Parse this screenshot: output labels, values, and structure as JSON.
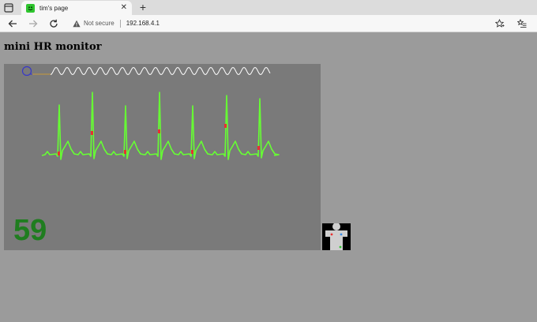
{
  "browser": {
    "tab_title": "tim's page",
    "tab_close_glyph": "✕",
    "new_tab_glyph": "+",
    "security_label": "Not secure",
    "url": "192.168.4.1"
  },
  "page": {
    "title": "mini HR monitor",
    "heart_rate": "59"
  },
  "colors": {
    "page_background": "#9b9b9b",
    "monitor_background": "#7a7a7a",
    "ecg_trace": "#66ff33",
    "beat_marker": "#e83030",
    "heart_rate_text": "#1f7d1f",
    "pulse_wave": "#ffffff"
  },
  "icons": [
    "tab-actions-icon",
    "smiley-favicon-icon",
    "close-icon",
    "plus-icon",
    "back-arrow-icon",
    "forward-arrow-icon",
    "refresh-icon",
    "warning-icon",
    "favorite-star-icon",
    "favorites-list-icon",
    "circle-marker-icon"
  ]
}
